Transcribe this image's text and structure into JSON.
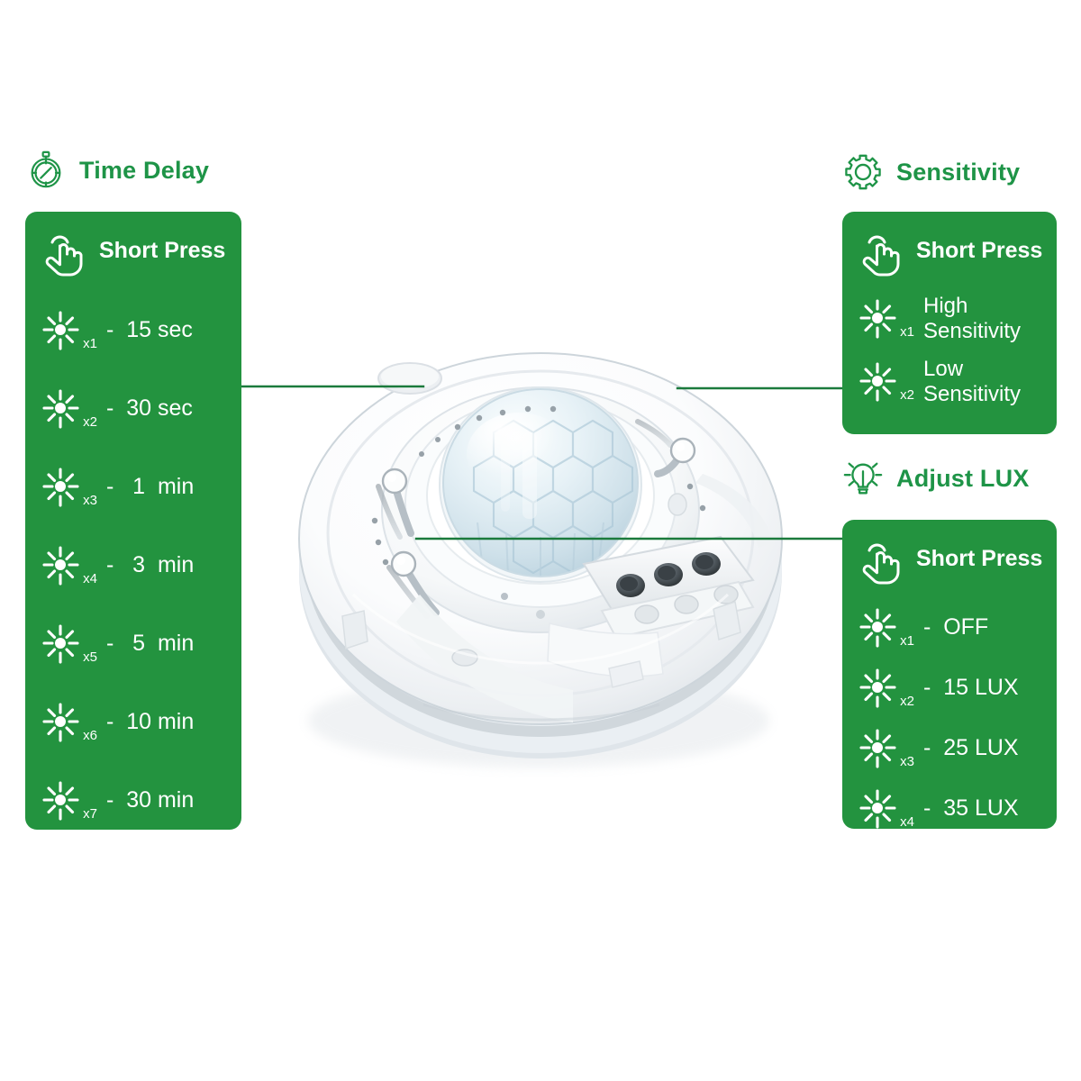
{
  "meta": {
    "panel_green": "#23933f",
    "title_green": "#1e9447",
    "text_white": "#ffffff",
    "background": "#ffffff",
    "connector_green": "#1b7a3c"
  },
  "sections": {
    "time_delay": {
      "icon": "stopwatch-icon",
      "title": "Time Delay",
      "press_icon": "tap-hand-icon",
      "press_label": "Short Press",
      "rows": [
        {
          "blink_icon": "blink-flash-icon",
          "count": "x1",
          "value": "-  15 sec"
        },
        {
          "blink_icon": "blink-flash-icon",
          "count": "x2",
          "value": "-  30 sec"
        },
        {
          "blink_icon": "blink-flash-icon",
          "count": "x3",
          "value": "-   1  min"
        },
        {
          "blink_icon": "blink-flash-icon",
          "count": "x4",
          "value": "-   3  min"
        },
        {
          "blink_icon": "blink-flash-icon",
          "count": "x5",
          "value": "-   5  min"
        },
        {
          "blink_icon": "blink-flash-icon",
          "count": "x6",
          "value": "-  10 min"
        },
        {
          "blink_icon": "blink-flash-icon",
          "count": "x7",
          "value": "-  30 min"
        }
      ]
    },
    "sensitivity": {
      "icon": "gear-icon",
      "title": "Sensitivity",
      "press_icon": "tap-hand-icon",
      "press_label": "Short Press",
      "rows": [
        {
          "blink_icon": "blink-flash-icon",
          "count": "x1",
          "line1": "High",
          "line2": "Sensitivity"
        },
        {
          "blink_icon": "blink-flash-icon",
          "count": "x2",
          "line1": "Low",
          "line2": "Sensitivity"
        }
      ]
    },
    "adjust_lux": {
      "icon": "lightbulb-icon",
      "title": "Adjust LUX",
      "press_icon": "tap-hand-icon",
      "press_label": "Short Press",
      "rows": [
        {
          "blink_icon": "blink-flash-icon",
          "count": "x1",
          "value": "-  OFF"
        },
        {
          "blink_icon": "blink-flash-icon",
          "count": "x2",
          "value": "-  15 LUX"
        },
        {
          "blink_icon": "blink-flash-icon",
          "count": "x3",
          "value": "-  25 LUX"
        },
        {
          "blink_icon": "blink-flash-icon",
          "count": "x4",
          "value": "-  35 LUX"
        }
      ]
    }
  },
  "product": {
    "name": "ceiling-pir-motion-sensor",
    "description": "White round ceiling-mounted PIR occupancy sensor with honeycomb Fresnel lens dome, three adjustment sliders and a wiring terminal block"
  }
}
